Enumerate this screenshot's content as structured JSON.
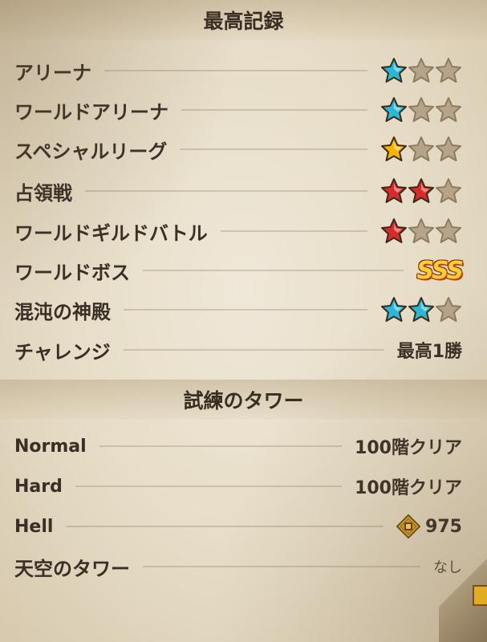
{
  "colors": {
    "star_blue": "#2bb7d6",
    "star_gold": "#f4b400",
    "star_red": "#d72b2b",
    "star_empty": "#b6a489"
  },
  "records": {
    "title": "最高記録",
    "rows": [
      {
        "label": "アリーナ",
        "stars": {
          "filled": 1,
          "total": 3,
          "color": "blue"
        }
      },
      {
        "label": "ワールドアリーナ",
        "stars": {
          "filled": 1,
          "total": 3,
          "color": "blue"
        }
      },
      {
        "label": "スペシャルリーグ",
        "stars": {
          "filled": 1,
          "total": 3,
          "color": "gold"
        }
      },
      {
        "label": "占領戦",
        "stars": {
          "filled": 2,
          "total": 3,
          "color": "red"
        }
      },
      {
        "label": "ワールドギルドバトル",
        "stars": {
          "filled": 1,
          "total": 3,
          "color": "red"
        }
      },
      {
        "label": "ワールドボス",
        "rank": "SSS"
      },
      {
        "label": "混沌の神殿",
        "stars": {
          "filled": 2,
          "total": 3,
          "color": "blue"
        }
      },
      {
        "label": "チャレンジ",
        "value": "最高1勝"
      }
    ]
  },
  "tower": {
    "title": "試練のタワー",
    "rows": [
      {
        "label": "Normal",
        "value": "100階クリア"
      },
      {
        "label": "Hard",
        "value": "100階クリア"
      },
      {
        "label": "Hell",
        "value": "975",
        "icon": "medal-icon"
      },
      {
        "label": "天空のタワー",
        "value": "なし"
      }
    ]
  }
}
